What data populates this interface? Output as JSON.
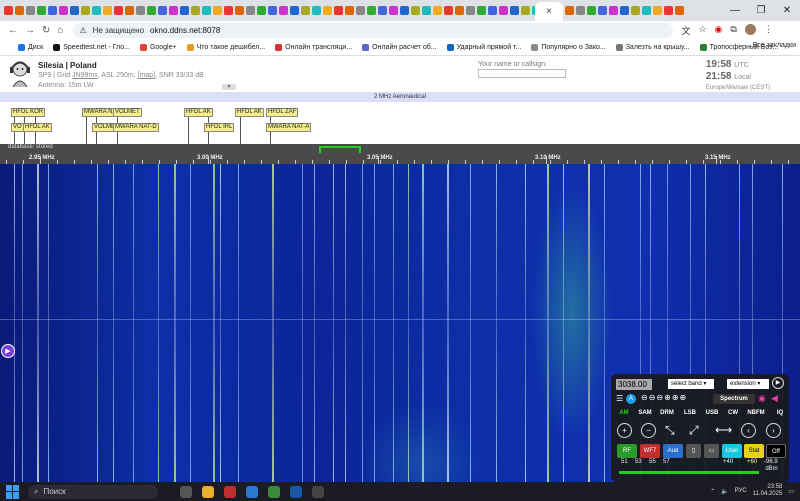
{
  "browser": {
    "active_tab_close": "×",
    "window_controls": [
      "—",
      "❐",
      "✕"
    ],
    "nav": {
      "back": "←",
      "forward": "→",
      "reload": "↻",
      "home": "⌂"
    },
    "security_label": "Не защищено",
    "url": "okno.ddns.net:8078",
    "bookmarks": [
      {
        "label": "Диск",
        "color": "#1a73e8"
      },
      {
        "label": "Speedtest.net - Гло...",
        "color": "#111111"
      },
      {
        "label": "Google+",
        "color": "#db4437"
      },
      {
        "label": "Что такое дешибел...",
        "color": "#e39b2b"
      },
      {
        "label": "Онлайн трансляци...",
        "color": "#d33333"
      },
      {
        "label": "Онлайн расчет об...",
        "color": "#5c6bc0"
      },
      {
        "label": "Ударный прямой т...",
        "color": "#1565c0"
      },
      {
        "label": "Популярно о Зако...",
        "color": "#888888"
      },
      {
        "label": "Залезть на крышу...",
        "color": "#777777"
      },
      {
        "label": "Тропосферный Воз...",
        "color": "#2e7d32"
      }
    ],
    "all_bookmarks": "Все закладки"
  },
  "site": {
    "title": "Silesia | Poland",
    "grid_line_prefix": "SP9 | Grid ",
    "grid_locator": "JN99mx",
    "grid_line_mid": ", ASL 250m, ",
    "map_link": "[map]",
    "grid_line_suffix": ", SNR 33/33 dB",
    "antenna": "Antenna: 15m LW",
    "callsign_label": "Your name or callsign:",
    "callsign_value": "",
    "utc_time": "19:58",
    "utc_label": "UTC",
    "local_time": "21:58",
    "local_label": "Local",
    "timezone": "Europe/Warsaw (CEST)"
  },
  "band_name": "2 MHz Aeronautical",
  "station_labels": [
    "HFDL KOR",
    "VO",
    "HFDL AK",
    "MWARA NA",
    "VOLMET",
    "VOLME",
    "MWARA NAT-D",
    "HFDL AK",
    "HFDL IRL",
    "HFDL AK",
    "HFDL ZAF",
    "MWARA NAT-A"
  ],
  "scale": {
    "database_label": "database: stored",
    "ticks": [
      "2.95 MHz",
      "3.00 MHz",
      "3.05 MHz",
      "3.10 MHz",
      "3.15 MHz"
    ]
  },
  "panel": {
    "frequency": "3038.00",
    "band_select": "select band",
    "ext_select": "extension",
    "spectrum": "Spectrum",
    "modes": [
      "AM",
      "SAM",
      "DRM",
      "LSB",
      "USB",
      "CW",
      "NBFM",
      "IQ"
    ],
    "buttons": [
      "RF",
      "WF7",
      "Aud",
      "User",
      "Stat",
      "Off"
    ],
    "smeter_scale": [
      "51",
      "53",
      "55",
      "57",
      "+40",
      "+60"
    ],
    "dbm_value": "-96.9",
    "dbm_unit": "dBm"
  },
  "taskbar": {
    "search": "Поиск",
    "lang": "РУС",
    "time": "23:58",
    "date": "11.04.2025"
  },
  "colors": {
    "waterfall_bg": "#0b1f8c",
    "label_bg": "#f4ef8a",
    "passband": "#19d219",
    "am_active": "#1fd01f"
  }
}
